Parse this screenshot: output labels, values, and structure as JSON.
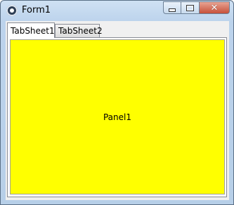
{
  "window": {
    "title": "Form1",
    "icon": "paw-icon"
  },
  "title_buttons": {
    "minimize": "minimize-icon",
    "maximize": "maximize-icon",
    "close": "close-icon"
  },
  "tabs": [
    {
      "label": "TabSheet1",
      "active": true
    },
    {
      "label": "TabSheet2",
      "active": false
    }
  ],
  "panel": {
    "caption": "Panel1",
    "color": "#ffff00"
  }
}
